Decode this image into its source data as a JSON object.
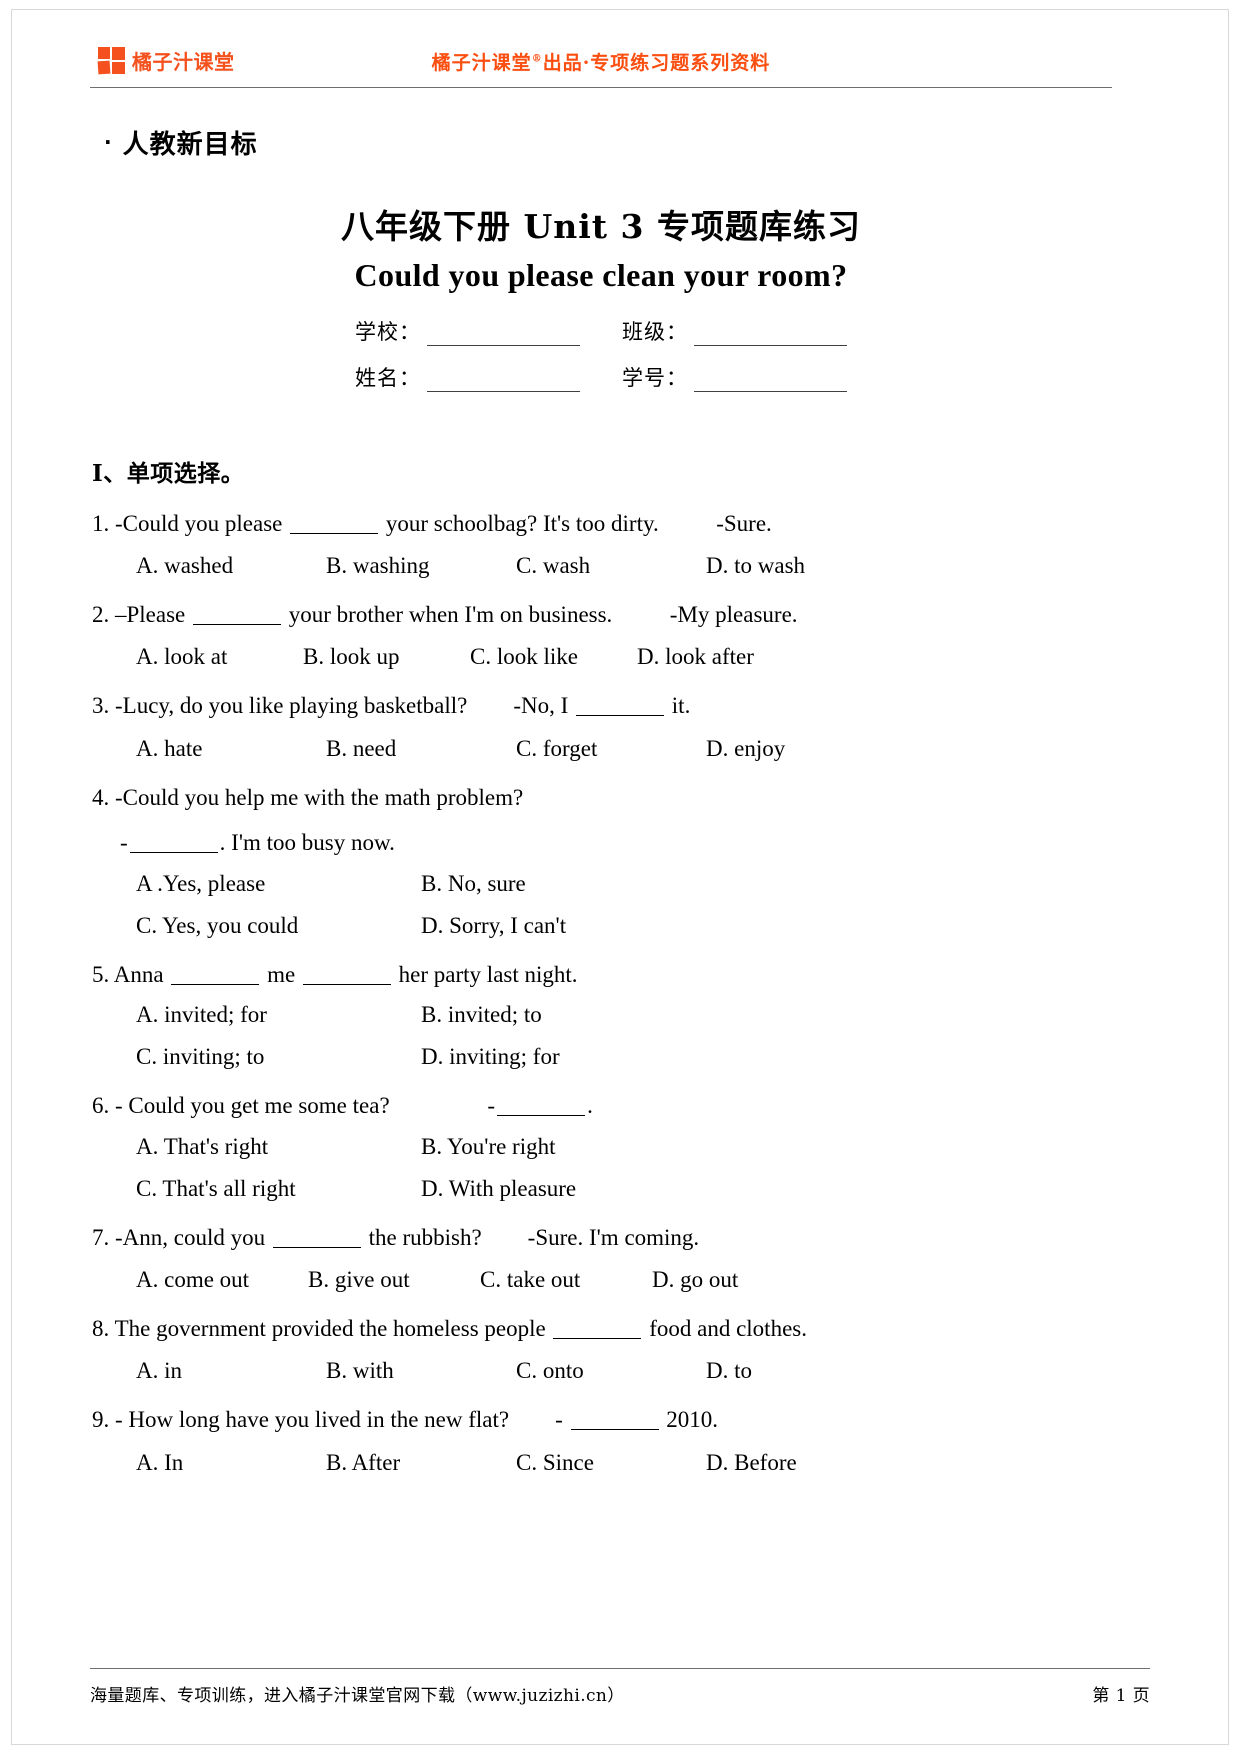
{
  "header": {
    "logo_text": "橘子汁课堂",
    "logo_icon": "four-square-logo-icon",
    "center_text_before": "橘子汁课堂",
    "center_reg_mark": "®",
    "center_text_after": "出品·专项练习题系列资料",
    "brand_color": "#f4511e"
  },
  "book_label": {
    "bullet": "·",
    "text": "人教新目标"
  },
  "title": {
    "cn": "八年级下册 Unit 3 专项题库练习",
    "en": "Could you please clean your room?"
  },
  "form": {
    "rows": [
      [
        {
          "label": "学校："
        },
        {
          "label": "班级："
        }
      ],
      [
        {
          "label": "姓名："
        },
        {
          "label": "学号："
        }
      ]
    ]
  },
  "section": {
    "heading": "I、单项选择。",
    "questions": [
      {
        "stem": "1. -Could you please ",
        "stem_mid": " your schoolbag? It's too dirty.          -Sure.",
        "blanks": 1,
        "layout": "cols4",
        "width": "w1",
        "options": [
          "A. washed",
          "B. washing",
          "C. wash",
          "D. to wash"
        ]
      },
      {
        "stem": "2. –Please ",
        "stem_mid": " your brother when I'm on business.          -My pleasure.",
        "blanks": 1,
        "layout": "cols4",
        "width": "w2",
        "options": [
          "A. look at",
          "B. look up",
          "C. look like",
          "D. look after"
        ]
      },
      {
        "stem": "3. -Lucy, do you like playing basketball?        -No, I ",
        "stem_mid": " it.",
        "blanks": 1,
        "layout": "cols4",
        "width": "w1",
        "options": [
          "A. hate",
          "B. need",
          "C. forget",
          "D. enjoy"
        ]
      },
      {
        "stem": "4. -Could you help me with the math problem?",
        "stem_mid": "",
        "blanks": 0,
        "stem_line2_pre": "-",
        "stem_line2_post": ". I'm too busy now.",
        "layout": "stack2",
        "options": [
          "A .Yes, please",
          "B. No, sure",
          "C. Yes, you could",
          "D. Sorry, I can't"
        ]
      },
      {
        "stem": "5. Anna ",
        "stem_mid": " me ",
        "stem_tail": " her party last night.",
        "blanks": 2,
        "layout": "stack2",
        "options": [
          "A. invited; for",
          "B. invited; to",
          "C. inviting; to",
          "D. inviting; for"
        ]
      },
      {
        "stem": "6. - Could you get me some tea?                 -",
        "stem_mid": ".",
        "blanks": 1,
        "layout": "stack2",
        "options": [
          "A. That's right",
          "B. You're right",
          "C. That's all right",
          "D. With pleasure"
        ]
      },
      {
        "stem": "7. -Ann, could you ",
        "stem_mid": " the rubbish?        -Sure. I'm coming.",
        "blanks": 1,
        "layout": "cols4",
        "width": "w3",
        "options": [
          "A. come out",
          "B. give out",
          "C. take out",
          "D. go out"
        ]
      },
      {
        "stem": "8. The government provided the homeless people ",
        "stem_mid": " food and clothes.",
        "blanks": 1,
        "layout": "cols4",
        "width": "w1",
        "options": [
          "A. in",
          "B. with",
          "C. onto",
          "D. to"
        ]
      },
      {
        "stem": "9. - How long have you lived in the new flat?        - ",
        "stem_mid": " 2010.",
        "blanks": 1,
        "layout": "cols4",
        "width": "w1",
        "options": [
          "A. In",
          "B. After",
          "C. Since",
          "D. Before"
        ]
      }
    ]
  },
  "footer": {
    "left": "海量题库、专项训练，进入橘子汁课堂官网下载（www.juzizhi.cn）",
    "right": "第 1 页"
  }
}
